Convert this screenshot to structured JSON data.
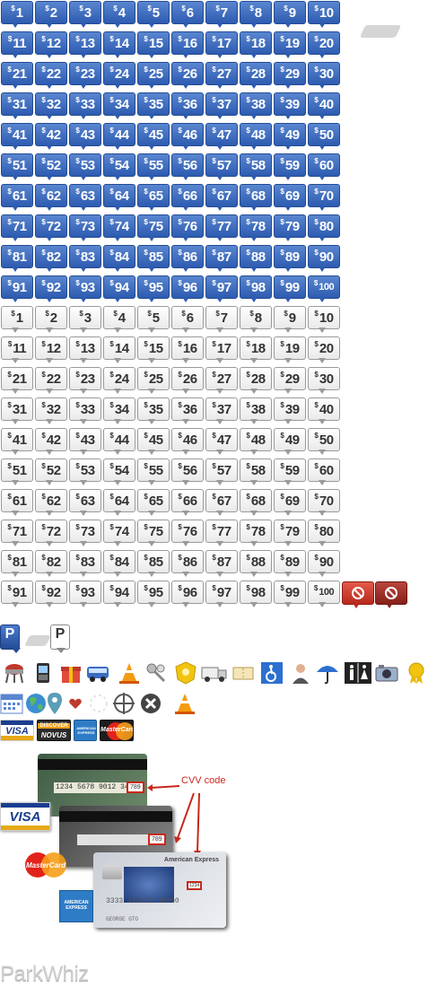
{
  "markers": {
    "currency_symbol": "$",
    "blue_values": [
      "1",
      "2",
      "3",
      "4",
      "5",
      "6",
      "7",
      "8",
      "9",
      "10",
      "11",
      "12",
      "13",
      "14",
      "15",
      "16",
      "17",
      "18",
      "19",
      "20",
      "21",
      "22",
      "23",
      "24",
      "25",
      "26",
      "27",
      "28",
      "29",
      "30",
      "31",
      "32",
      "33",
      "34",
      "35",
      "36",
      "37",
      "38",
      "39",
      "40",
      "41",
      "42",
      "43",
      "44",
      "45",
      "46",
      "47",
      "48",
      "49",
      "50",
      "51",
      "52",
      "53",
      "54",
      "55",
      "56",
      "57",
      "58",
      "59",
      "60",
      "61",
      "62",
      "63",
      "64",
      "65",
      "66",
      "67",
      "68",
      "69",
      "70",
      "71",
      "72",
      "73",
      "74",
      "75",
      "76",
      "77",
      "78",
      "79",
      "80",
      "81",
      "82",
      "83",
      "84",
      "85",
      "86",
      "87",
      "88",
      "89",
      "90",
      "91",
      "92",
      "93",
      "94",
      "95",
      "96",
      "97",
      "98",
      "99",
      "100"
    ],
    "white_values": [
      "1",
      "2",
      "3",
      "4",
      "5",
      "6",
      "7",
      "8",
      "9",
      "10",
      "11",
      "12",
      "13",
      "14",
      "15",
      "16",
      "17",
      "18",
      "19",
      "20",
      "21",
      "22",
      "23",
      "24",
      "25",
      "26",
      "27",
      "28",
      "29",
      "30",
      "31",
      "32",
      "33",
      "34",
      "35",
      "36",
      "37",
      "38",
      "39",
      "40",
      "41",
      "42",
      "43",
      "44",
      "45",
      "46",
      "47",
      "48",
      "49",
      "50",
      "51",
      "52",
      "53",
      "54",
      "55",
      "56",
      "57",
      "58",
      "59",
      "60",
      "61",
      "62",
      "63",
      "64",
      "65",
      "66",
      "67",
      "68",
      "69",
      "70",
      "71",
      "72",
      "73",
      "74",
      "75",
      "76",
      "77",
      "78",
      "79",
      "80",
      "81",
      "82",
      "83",
      "84",
      "85",
      "86",
      "87",
      "88",
      "89",
      "90",
      "91",
      "92",
      "93",
      "94",
      "95",
      "96",
      "97",
      "98",
      "99",
      "100"
    ],
    "blue_color": "#2d5bb0",
    "red_color": "#c8281c"
  },
  "parking": {
    "letter": "P"
  },
  "icons_row1": [
    "grill-icon",
    "phone-icon",
    "gift-icon",
    "shuttle-icon",
    "traffic-cone-icon",
    "keys-icon",
    "badge-icon",
    "truck-icon",
    "ticket-icon",
    "wheelchair-icon",
    "attendant-icon",
    "umbrella-icon",
    "restroom-icon",
    "camera-icon",
    "award-icon"
  ],
  "icons_row2": [
    "calendar-icon",
    "globe-icon",
    "location-pin-icon",
    "heart-icon",
    "loading-icon",
    "crosshair-icon",
    "close-icon",
    "traffic-cone-icon"
  ],
  "cards": {
    "visa": "VISA",
    "discover": "DISCOVER",
    "novus": "NOVUS",
    "amex": "AMERICAN EXPRESS",
    "mastercard": "MasterCard"
  },
  "cvv": {
    "label": "CVV code",
    "card_number_1": "1234 5678 9012 3456",
    "cvv_1": "789",
    "cvv_2": "789",
    "amex_title": "American Express",
    "amex_number": "3333 122222 10000",
    "amex_cvv": "1234",
    "amex_name": "GEORGE GTO"
  },
  "logo": {
    "text": "ParkWhiz"
  }
}
